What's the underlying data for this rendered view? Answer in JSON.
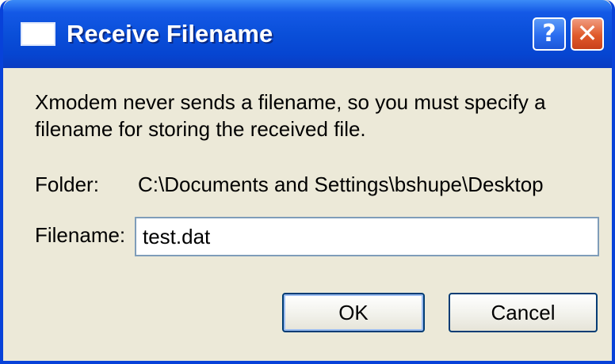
{
  "window": {
    "title": "Receive Filename",
    "help_glyph": "?",
    "close_glyph": "✕",
    "icon": "window-icon"
  },
  "dialog": {
    "message": "Xmodem never sends a filename, so you must specify a filename for storing the received file.",
    "folder_label": "Folder:",
    "folder_value": "C:\\Documents and Settings\\bshupe\\Desktop",
    "filename_label": "Filename:",
    "filename_value": "test.dat"
  },
  "buttons": {
    "ok_label": "OK",
    "cancel_label": "Cancel"
  },
  "colors": {
    "titlebar": "#0a4fd9",
    "dialog_bg": "#ece9d8",
    "close_button": "#e05a2b",
    "input_border": "#7f9db9",
    "default_button_border": "#003c74"
  }
}
